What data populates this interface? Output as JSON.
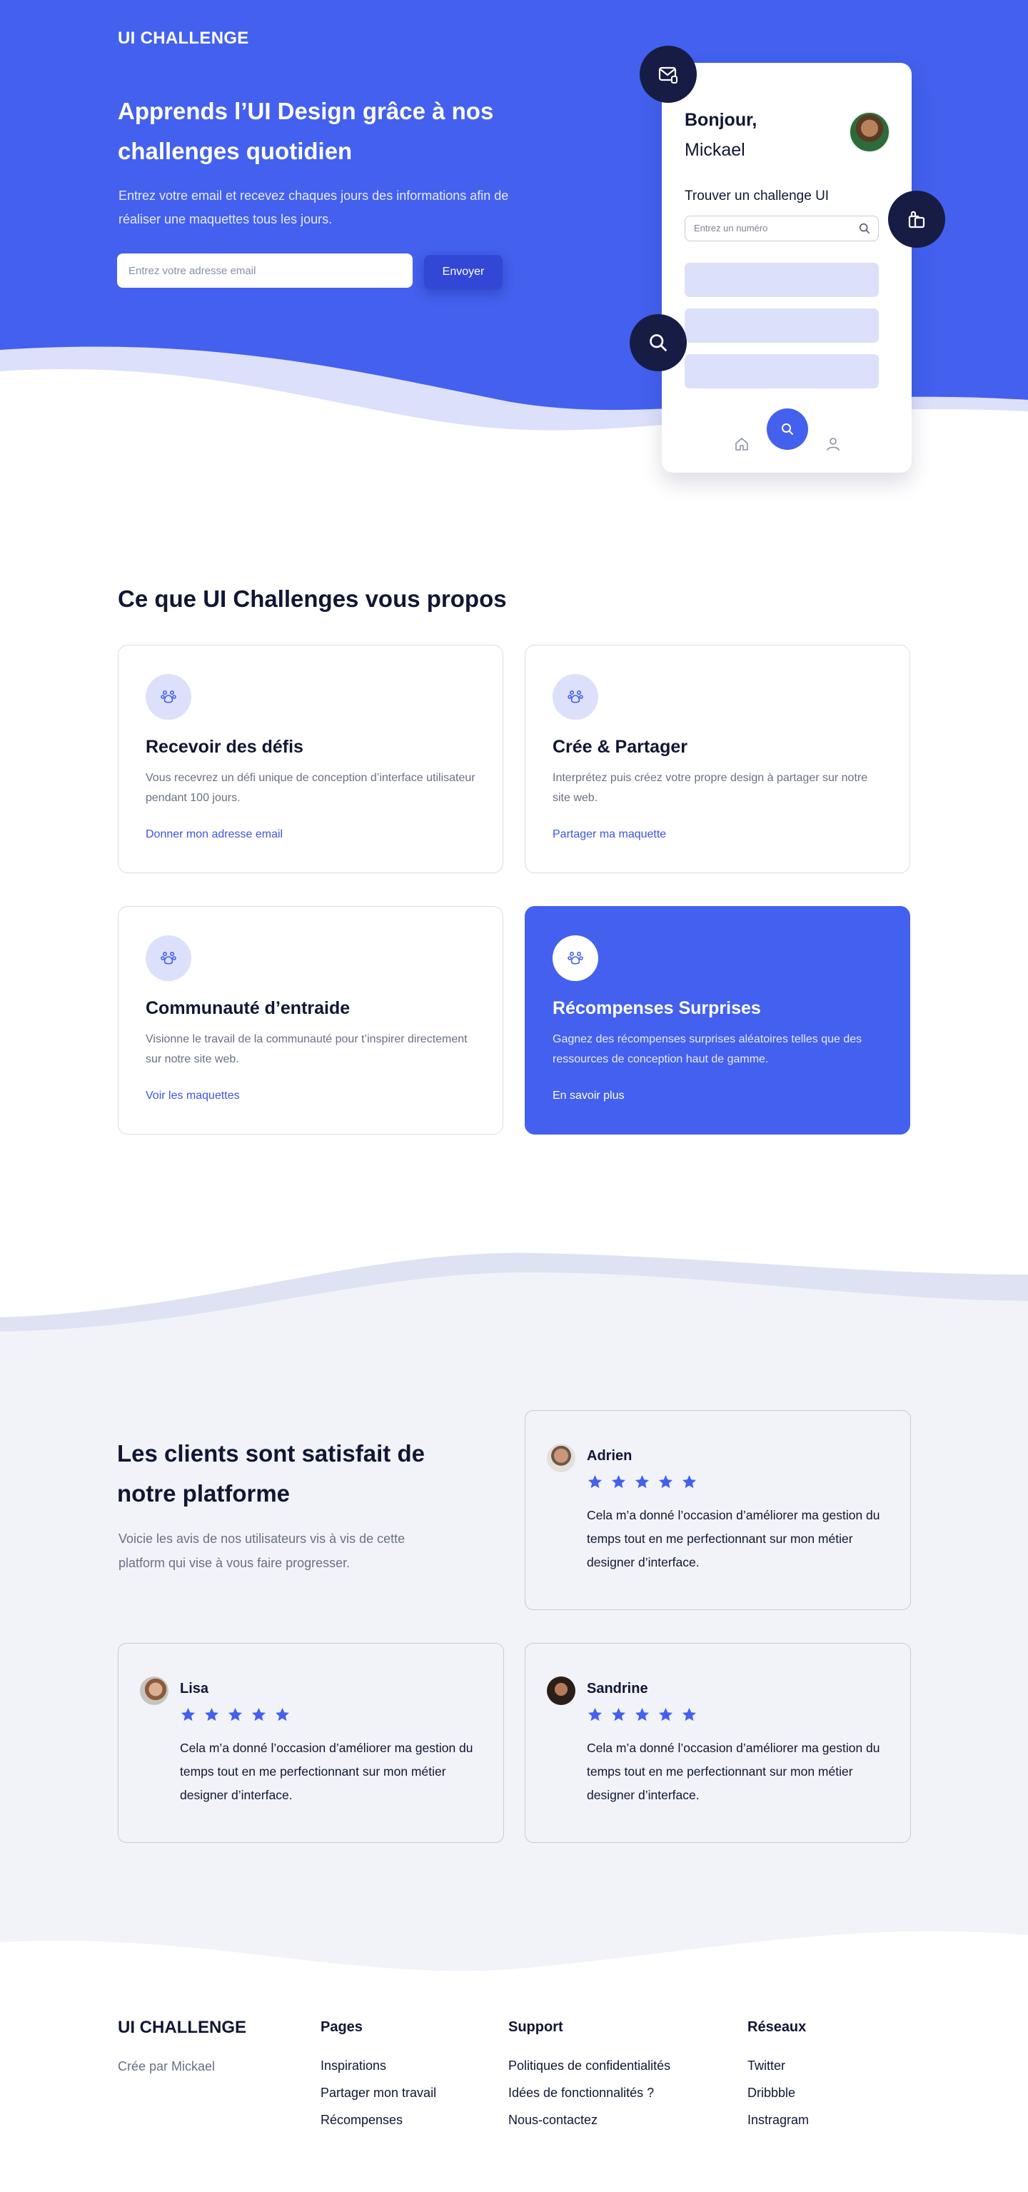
{
  "colors": {
    "primary": "#4360ee",
    "dark": "#161c44",
    "light_blue": "#dde0fb",
    "section_bg": "#f2f3f8"
  },
  "hero": {
    "logo": "UI CHALLENGE",
    "title": "Apprends l’UI Design grâce à nos challenges quotidien",
    "description": "Entrez votre email et recevez chaques jours des informations afin de réaliser une maquettes tous les jours.",
    "email_placeholder": "Entrez votre adresse email",
    "send_label": "Envoyer"
  },
  "phone": {
    "greeting": "Bonjour,",
    "name": "Mickael",
    "subtitle": "Trouver un challenge UI",
    "search_placeholder": "Entrez un numéro"
  },
  "features": {
    "title": "Ce que UI Challenges vous propos",
    "cards": [
      {
        "title": "Recevoir des défis",
        "description": "Vous recevrez un défi unique de conception d’interface utilisateur pendant 100 jours.",
        "link": "Donner mon adresse email",
        "icon": "paw-icon",
        "active": false
      },
      {
        "title": "Crée & Partager",
        "description": "Interprétez puis créez votre propre design à partager sur notre site web.",
        "link": "Partager ma maquette",
        "icon": "paw-icon",
        "active": false
      },
      {
        "title": "Communauté d’entraide",
        "description": "Visionne le travail de la communauté pour t’inspirer directement sur notre site web.",
        "link": "Voir les maquettes",
        "icon": "paw-icon",
        "active": false
      },
      {
        "title": "Récompenses Surprises",
        "description": "Gagnez des récompenses surprises aléatoires telles que des ressources de conception haut de gamme.",
        "link": "En savoir plus",
        "icon": "paw-icon",
        "active": true
      }
    ]
  },
  "testimonials": {
    "title": "Les clients sont satisfait de notre platforme",
    "description": "Voicie les avis de nos utilisateurs vis à vis de cette platform qui vise à vous faire progresser.",
    "reviews": [
      {
        "name": "Adrien",
        "rating": 5,
        "text": "Cela m’a donné l’occasion d’améliorer ma gestion du temps tout en me perfectionnant sur mon métier designer d’interface."
      },
      {
        "name": "Lisa",
        "rating": 5,
        "text": "Cela m’a donné l’occasion d’améliorer ma gestion du temps tout en me perfectionnant sur mon métier designer d’interface."
      },
      {
        "name": "Sandrine",
        "rating": 5,
        "text": "Cela m’a donné l’occasion d’améliorer ma gestion du temps tout en me perfectionnant sur mon métier designer d’interface."
      }
    ]
  },
  "footer": {
    "logo": "UI CHALLENGE",
    "credit": "Crée par Mickael",
    "columns": [
      {
        "title": "Pages",
        "links": [
          "Inspirations",
          "Partager mon travail",
          "Récompenses"
        ]
      },
      {
        "title": "Support",
        "links": [
          "Politiques de confidentialités",
          "Idées de fonctionnalités ?",
          "Nous-contactez"
        ]
      },
      {
        "title": "Réseaux",
        "links": [
          "Twitter",
          "Dribbble",
          "Instragram"
        ]
      }
    ]
  }
}
